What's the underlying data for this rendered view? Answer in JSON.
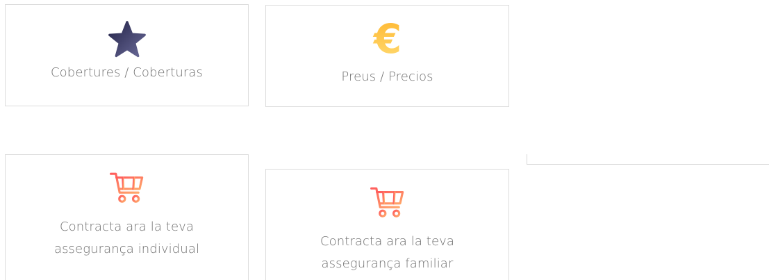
{
  "cards": [
    {
      "label": "Cobertures / Coberturas",
      "icon": "star-icon",
      "icon_color": "#3a3a6a"
    },
    {
      "label": "Preus / Precios",
      "icon": "euro-icon",
      "icon_color": "#ffc640"
    },
    {
      "label_line1": "Contracta ara la teva",
      "label_line2": "assegurança individual",
      "icon": "shopping-cart-icon",
      "icon_color": "#ff7f63"
    },
    {
      "label_line1": "Contracta ara la teva",
      "label_line2": "assegurança familiar",
      "icon": "shopping-cart-icon",
      "icon_color": "#ff7f63"
    }
  ]
}
